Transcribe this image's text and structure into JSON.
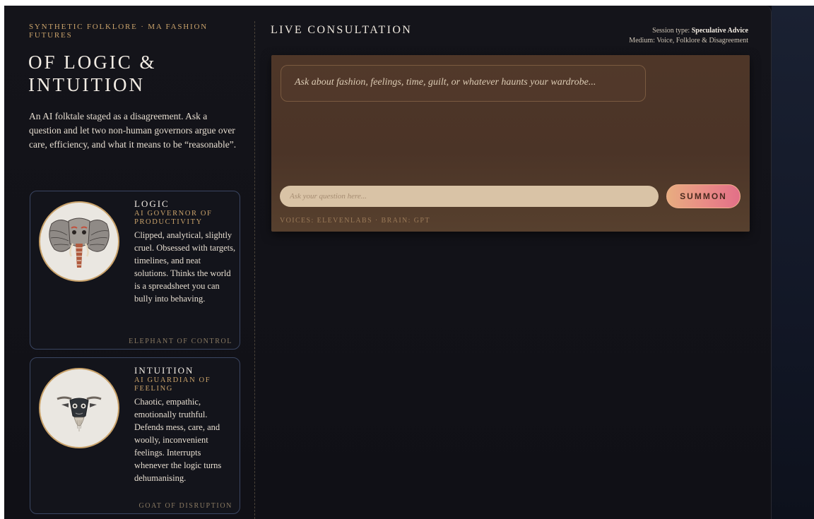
{
  "brand": {
    "kicker": "SYNTHETIC FOLKLORE · MA FASHION FUTURES",
    "title": "OF LOGIC & INTUITION",
    "intro": "An AI folktale staged as a disagreement. Ask a question and let two non-human governors argue over care, efficiency, and what it means to be “reasonable”."
  },
  "governors": [
    {
      "name": "LOGIC",
      "role": "AI GOVERNOR OF PRODUCTIVITY",
      "description": "Clipped, analytical, slightly cruel. Obsessed with targets, timelines, and neat solutions. Thinks the world is a spreadsheet you can bully into behaving.",
      "tag": "ELEPHANT OF CONTROL",
      "icon": "elephant-mask-icon"
    },
    {
      "name": "INTUITION",
      "role": "AI GUARDIAN OF FEELING",
      "description": "Chaotic, empathic, emotionally truthful. Defends mess, care, and woolly, inconvenient feelings. Interrupts whenever the logic turns dehumanising.",
      "tag": "GOAT OF DISRUPTION",
      "icon": "goat-mask-icon"
    }
  ],
  "consultation": {
    "title": "LIVE CONSULTATION",
    "session_type_label": "Session type:",
    "session_type_value": "Speculative Advice",
    "medium": "Medium: Voice, Folklore & Disagreement",
    "prompt": "Ask about fashion, feelings, time, guilt, or whatever haunts your wardrobe...",
    "input_placeholder": "Ask your question here...",
    "input_value": "",
    "summon_label": "SUMMON",
    "powered_by": "VOICES: ELEVENLABS · BRAIN: GPT"
  },
  "colors": {
    "accent_gold": "#c9a26a",
    "panel_brown": "#4e3628",
    "summon_gradient_start": "#e8ad80",
    "summon_gradient_end": "#e26f88",
    "card_border": "#3a4662"
  }
}
